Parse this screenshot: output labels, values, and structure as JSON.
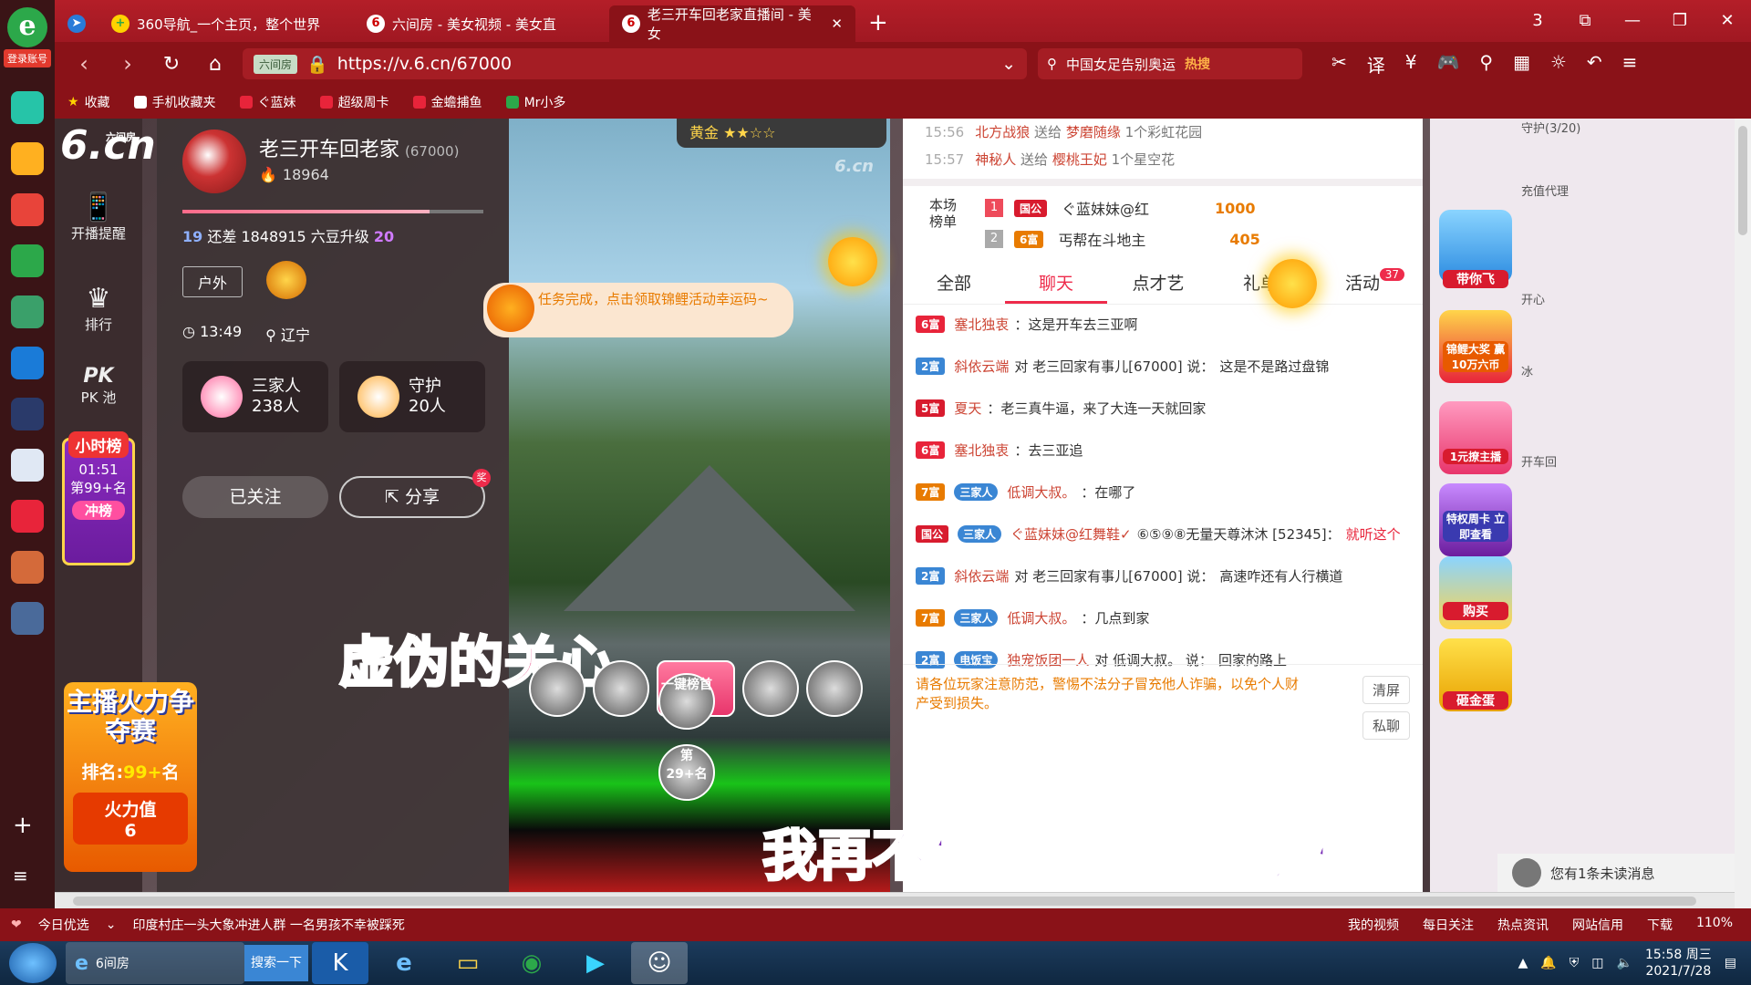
{
  "browser": {
    "login_label": "登录账号",
    "tabs": [
      {
        "title": "360导航_一个主页，整个世界"
      },
      {
        "title": "六间房 - 美女视频 - 美女直"
      },
      {
        "title": "老三开车回老家直播间 - 美女"
      }
    ],
    "new_tab": "+",
    "window_controls": [
      "3",
      "⧉",
      "—",
      "❐",
      "✕"
    ],
    "url": "https://v.6.cn/67000",
    "site_badge": "六间房",
    "search_text": "中国女足告别奥运",
    "search_hot": "热搜",
    "bookmarks": [
      "收藏",
      "手机收藏夹",
      "ぐ蓝妹",
      "超级周卡",
      "金蟾捕鱼",
      "Mr小多"
    ]
  },
  "site": {
    "logo": "6.cn",
    "logo_small": "六间房",
    "rail": [
      {
        "icon": "phone-icon",
        "label": "开播提醒"
      },
      {
        "icon": "crown-icon",
        "label": "排行"
      },
      {
        "icon": "pk-icon",
        "label": "PK 池"
      }
    ],
    "hour_board": {
      "title": "小时榜",
      "time": "01:51",
      "rank": "第99+名",
      "btn": "冲榜"
    }
  },
  "anchor": {
    "name": "老三开车回老家",
    "room_id": "(67000)",
    "fans": "18964",
    "progress": 0.82,
    "level_prefix": "19",
    "level_text": "还差 1848915 六豆升级",
    "level_next": "20",
    "tag": "户外",
    "time": "13:49",
    "location": "辽宁",
    "family_label": "三家人",
    "family_count": "238人",
    "guard_label": "守护",
    "guard_count": "20人",
    "follow_label": "已关注",
    "share_label": "分享",
    "share_badge": "奖"
  },
  "fire_contest": {
    "title": "主播火力争夺赛",
    "rank_prefix": "排名:",
    "rank": "99+",
    "rank_suffix": "名",
    "value_label": "火力值",
    "value": "6"
  },
  "video": {
    "watermark": "6.cn",
    "gold_badge": "黄金 ★★☆☆",
    "overlay_1": "虚伪的关心",
    "overlay_2": "我再不想听你们唱的那种",
    "gift_rank_title": "一键榜首",
    "gift_rank": "第29+名"
  },
  "gift_log": [
    {
      "time": "15:56",
      "user": "北方战狼",
      "act": "送给",
      "target": "梦磨随缘",
      "gift": "1个彩虹花园"
    },
    {
      "time": "15:57",
      "user": "神秘人",
      "act": "送给",
      "target": "樱桃王妃",
      "gift": "1个星空花"
    }
  ],
  "rank_box": {
    "title": "本场榜单",
    "rows": [
      {
        "no": "1",
        "level": "国公",
        "name": "ぐ蓝妹妹@红",
        "points": "1000"
      },
      {
        "no": "2",
        "level": "6富",
        "name": "丐帮在斗地主",
        "points": "405"
      }
    ]
  },
  "chat_tabs": [
    "全部",
    "聊天",
    "点才艺",
    "礼单",
    "活动"
  ],
  "chat_count": "37",
  "task_bubble": "任务完成，点击领取锦鲤活动幸运码~",
  "messages": [
    {
      "level": "6富",
      "user": "塞北独衷",
      "text": "：这是开车去三亚啊"
    },
    {
      "level": "2富",
      "user": "斜依云端",
      "to": "对 老三回家有事儿[67000] 说：",
      "text": "这是不是路过盘锦"
    },
    {
      "level": "5富",
      "user": "夏天",
      "text": "：老三真牛逼，来了大连一天就回家"
    },
    {
      "level": "6富",
      "user": "塞北独衷",
      "text": "：去三亚追"
    },
    {
      "level": "7富",
      "badge": "三家人",
      "user": "低调大叔。",
      "text": "：在哪了"
    },
    {
      "level": "国公",
      "badge": "三家人",
      "user": "ぐ蓝妹妹@红舞鞋✓",
      "extra": "⑥⑤⑨⑧无量天尊沐沐 [52345]：",
      "text": "就听这个"
    },
    {
      "level": "2富",
      "user": "斜依云端",
      "to": "对 老三回家有事儿[67000] 说：",
      "text": "高速咋还有人行横道"
    },
    {
      "level": "7富",
      "badge": "三家人",
      "user": "低调大叔。",
      "text": "：几点到家"
    },
    {
      "level": "2富",
      "badge": "电饭宝",
      "user": "独宠饭团一人",
      "to": "对 低调大叔。 说：",
      "text": "回家的路上"
    }
  ],
  "notice": "请各位玩家注意防范，警惕不法分子冒充他人诈骗，以免个人财产受到损失。",
  "notice_actions": [
    "清屏",
    "私聊"
  ],
  "unread": "您有1条未读消息",
  "right_promos": [
    "带你飞",
    "锦鲤大奖 赢10万六币",
    "1元撩主播",
    "特权周卡 立即查看",
    "购买",
    "砸金蛋"
  ],
  "right_guard": [
    "守护(3/20)",
    "充值代理",
    "开心",
    "冰",
    "开车回"
  ],
  "statusbar": {
    "left": [
      "今日优选",
      "印度村庄一头大象冲进人群 一名男孩不幸被踩死"
    ],
    "right": [
      "我的视频",
      "每日关注",
      "热点资讯",
      "网站信用",
      "下载",
      "110%"
    ]
  },
  "taskbar": {
    "browser_label": "6间房",
    "search_label": "搜索一下",
    "time": "15:58 周三",
    "date": "2021/7/28"
  },
  "colors": {
    "brand_red": "#b41e28",
    "chat_red": "#ee2b4b",
    "accent_orange": "#e87b00"
  }
}
